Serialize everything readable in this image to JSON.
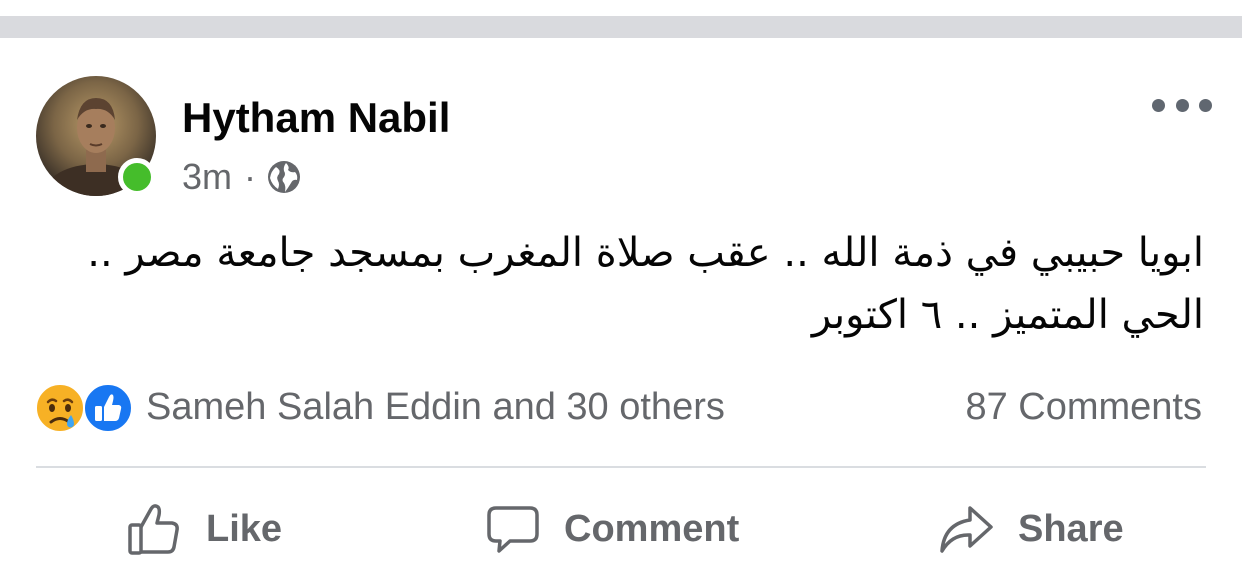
{
  "post": {
    "author": "Hytham Nabil",
    "time": "3m",
    "separator": "·",
    "privacy_icon": "globe-icon",
    "text_line1": "ابويا حبيبي في ذمة الله .. عقب صلاة المغرب بمسجد جامعة مصر ..",
    "text_line2": "الحي المتميز .. ٦ اكتوبر"
  },
  "reactions": {
    "icons": [
      "sad-face-icon",
      "like-badge-icon"
    ],
    "summary": "Sameh Salah Eddin and 30 others",
    "comments": "87 Comments"
  },
  "actions": {
    "like": "Like",
    "comment": "Comment",
    "share": "Share"
  },
  "colors": {
    "secondary_text": "#65676b",
    "online": "#45bd2b",
    "like_blue": "#1877f2",
    "divider": "#dadde1"
  }
}
